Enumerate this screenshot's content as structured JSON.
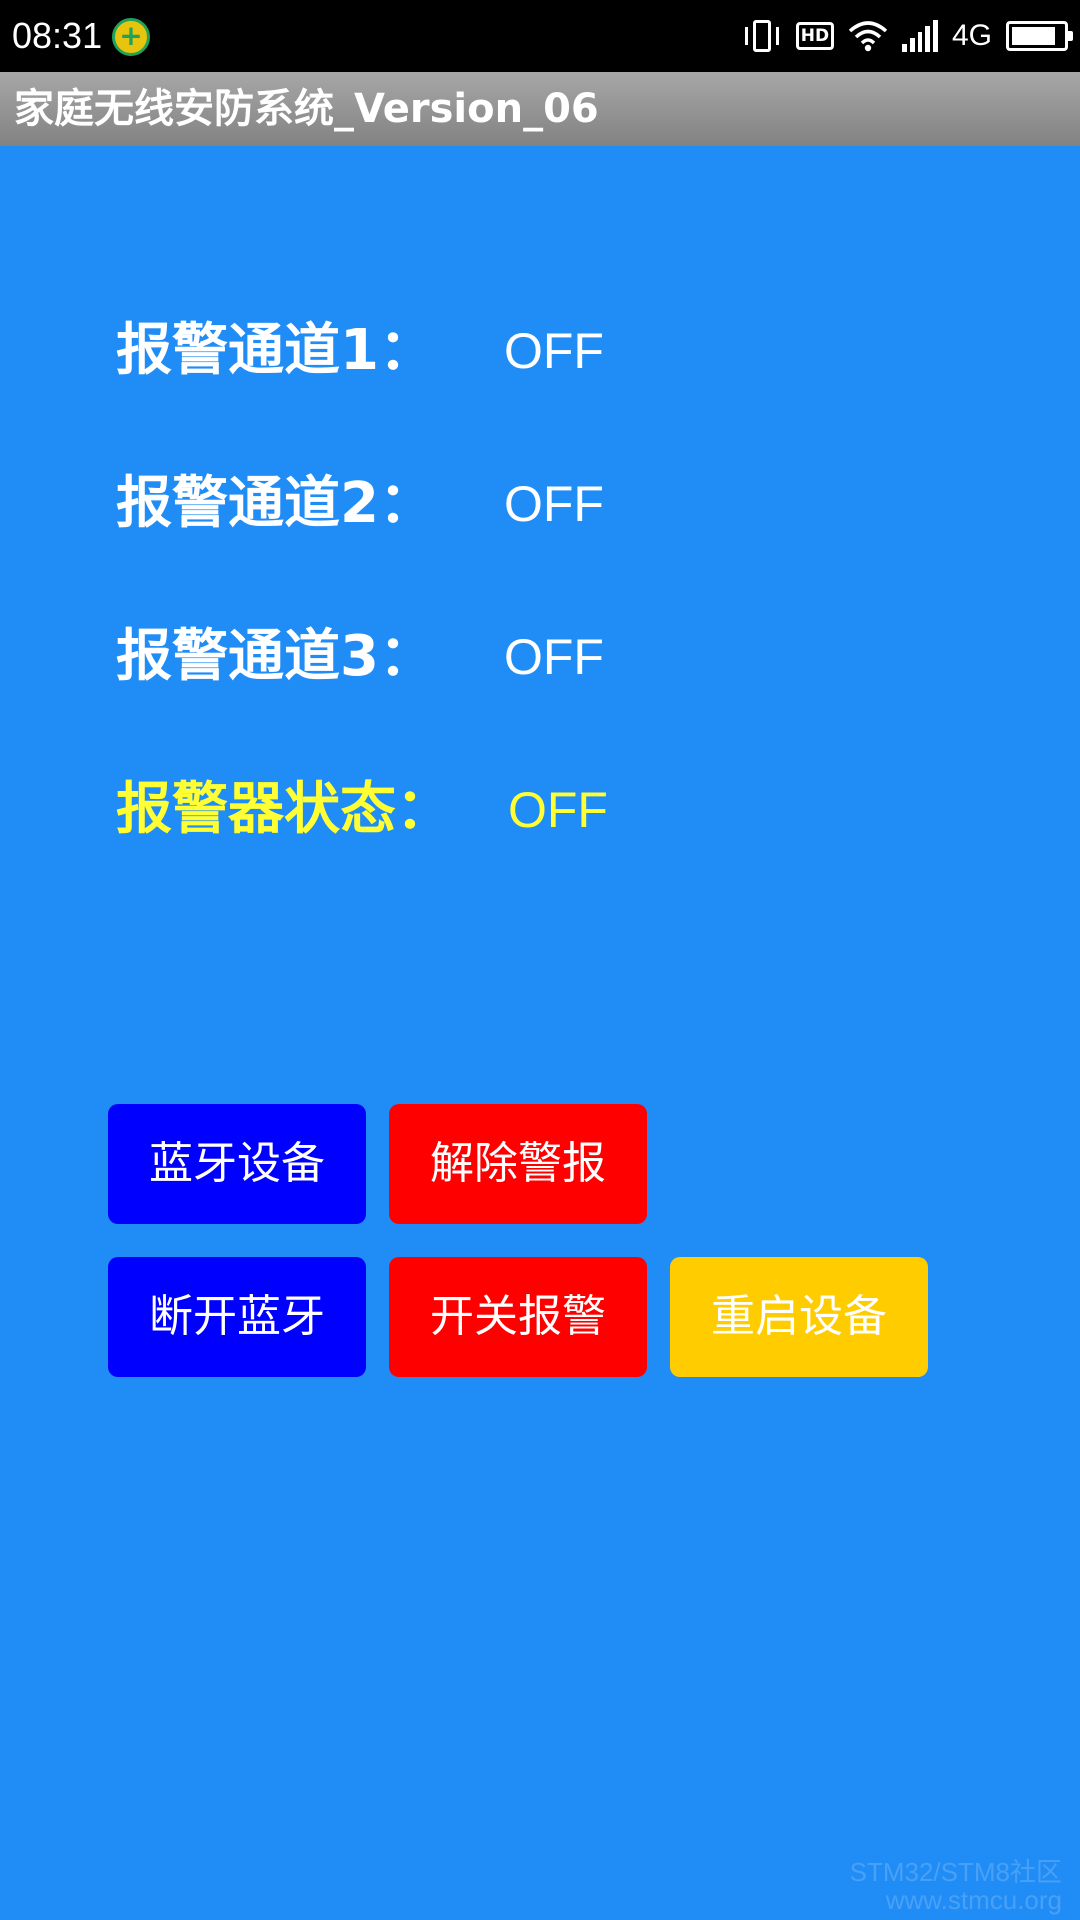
{
  "status_bar": {
    "time": "08:31",
    "app_icon": "plus-circle-icon",
    "hd_label": "HD",
    "network_type": "4G",
    "battery_level": 0.85,
    "icons": [
      "vibrate-icon",
      "hd-icon",
      "wifi-icon",
      "signal-icon",
      "battery-icon"
    ]
  },
  "app_title": "家庭无线安防系统_Version_06",
  "channels": [
    {
      "label": "报警通道1：",
      "value": "OFF"
    },
    {
      "label": "报警通道2：",
      "value": "OFF"
    },
    {
      "label": "报警通道3：",
      "value": "OFF"
    }
  ],
  "alarm_status": {
    "label": "报警器状态：",
    "value": "OFF"
  },
  "buttons": {
    "bluetooth_devices": "蓝牙设备",
    "clear_alarm": "解除警报",
    "disconnect_bluetooth": "断开蓝牙",
    "toggle_alarm": "开关报警",
    "restart_device": "重启设备"
  },
  "watermark": {
    "line1": "STM32/STM8社区",
    "line2": "www.stmcu.org"
  },
  "colors": {
    "background": "#208CF6",
    "title_bar": "#959595",
    "alarm_text": "#FFFF33",
    "button_blue": "#0000FF",
    "button_red": "#FF0000",
    "button_yellow": "#FFCC00"
  }
}
